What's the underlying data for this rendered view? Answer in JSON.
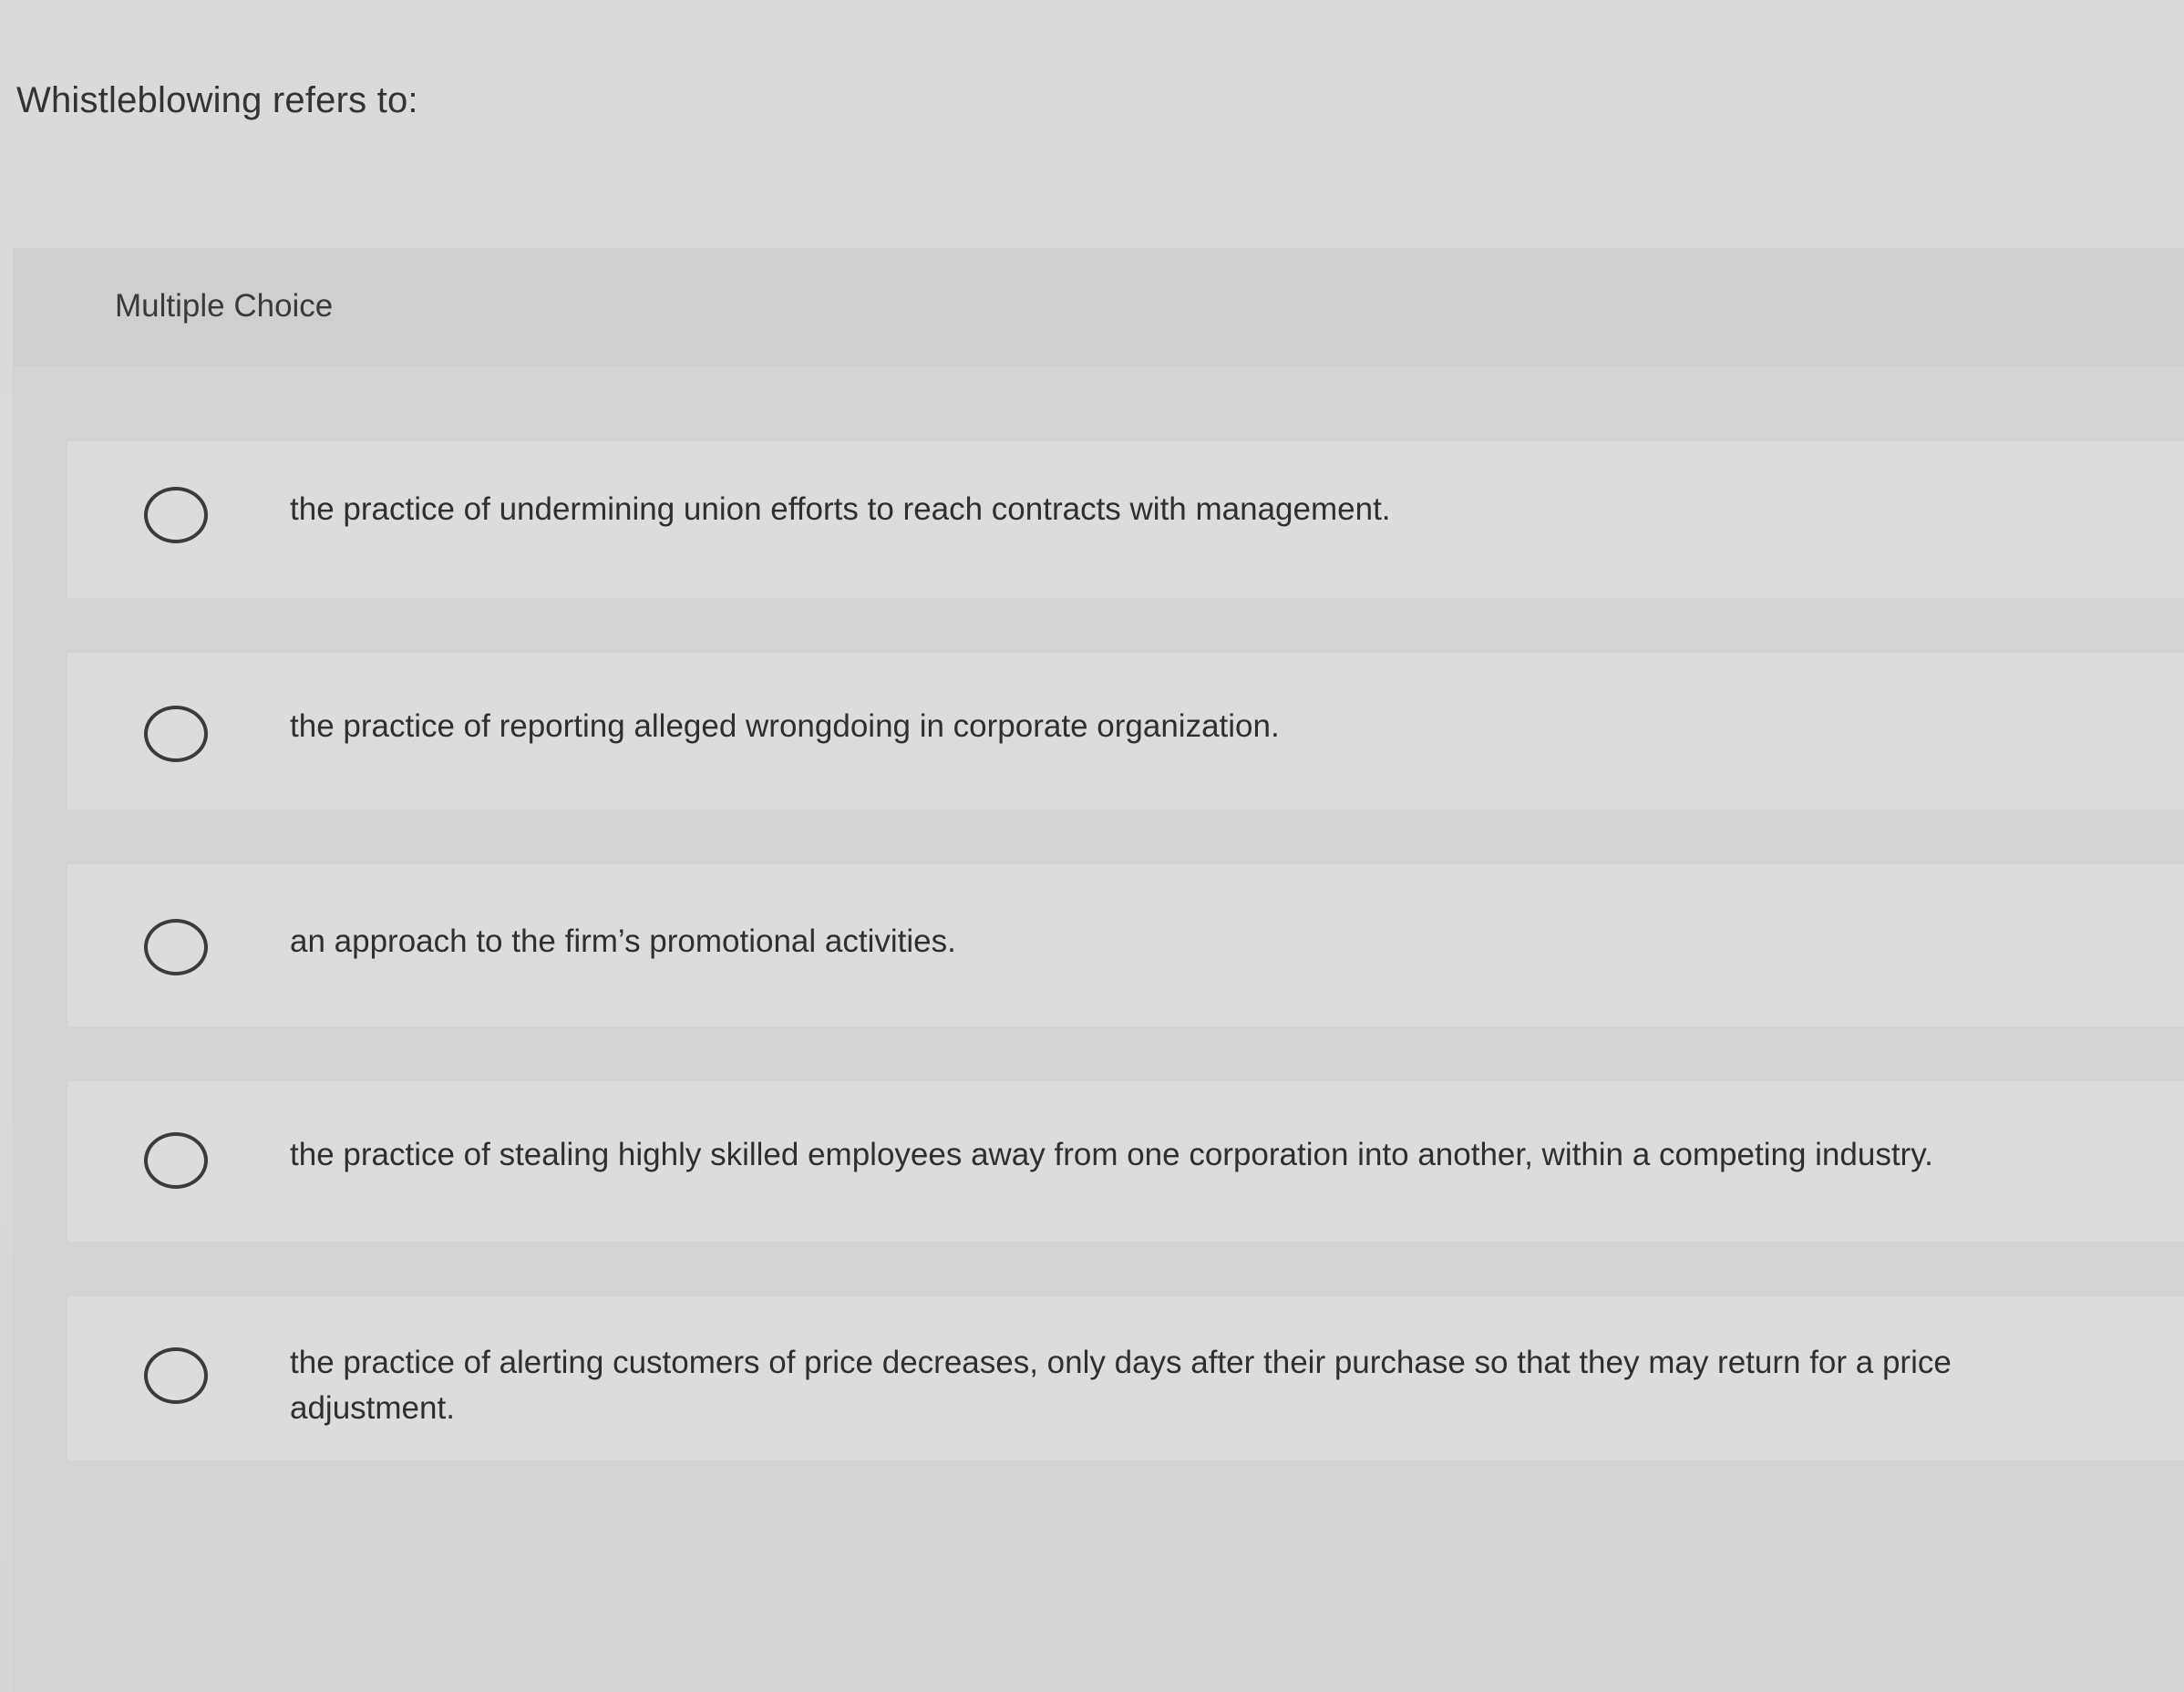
{
  "question": {
    "prompt": "Whistleblowing refers to:"
  },
  "section": {
    "type_label": "Multiple Choice"
  },
  "options": [
    {
      "label": "the practice of undermining union efforts to reach contracts with management."
    },
    {
      "label": "the practice of reporting alleged wrongdoing in corporate organization."
    },
    {
      "label": "an approach to the firm’s promotional activities."
    },
    {
      "label": "the practice of stealing highly skilled employees away from one corporation into another, within a competing industry."
    },
    {
      "label": "the practice of alerting customers of price decreases, only days after their purchase so that they may return for a price adjustment."
    }
  ]
}
